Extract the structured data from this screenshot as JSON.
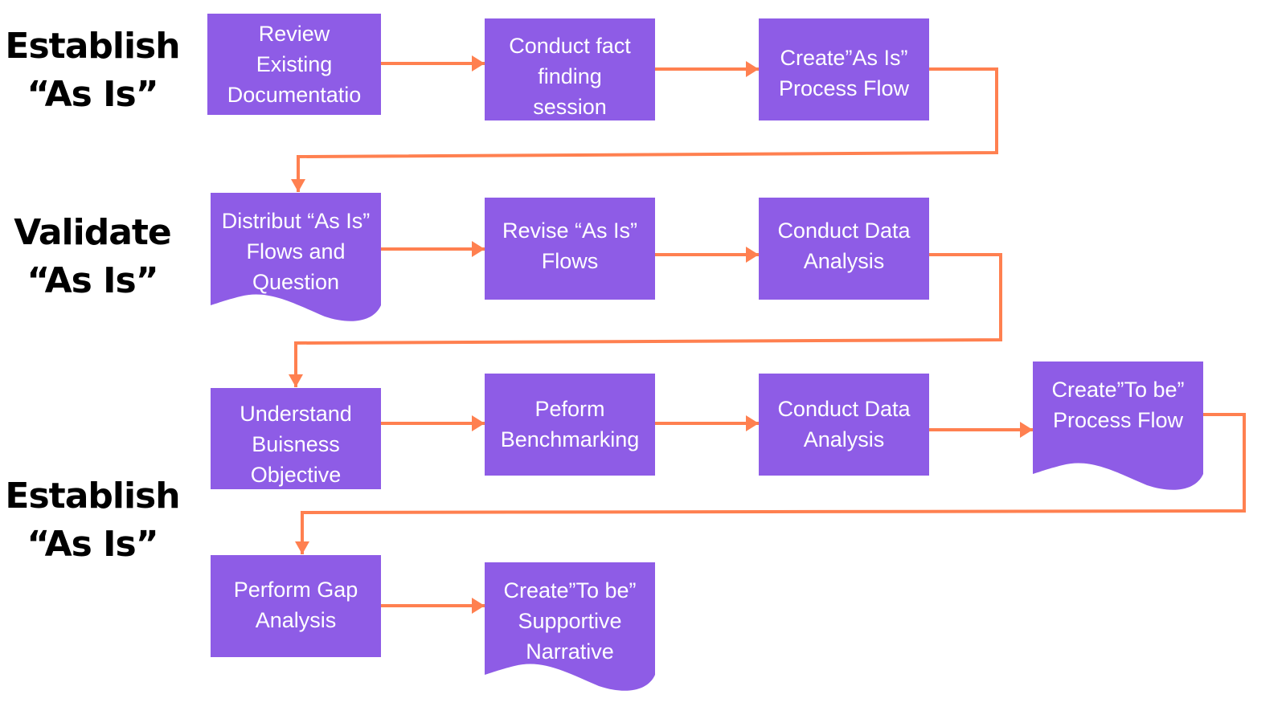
{
  "colors": {
    "box": "#8E5CE6",
    "connector": "#FF8050",
    "text": "#FFFFFF",
    "phase_text": "#000000"
  },
  "phases": [
    {
      "lines": [
        "Establish",
        "“As Is”"
      ]
    },
    {
      "lines": [
        "Validate",
        "“As Is”"
      ]
    },
    {
      "lines": [
        "Establish",
        "“As Is”"
      ]
    }
  ],
  "steps": [
    {
      "shape": "process",
      "lines": [
        "Review",
        "Existing",
        "Documentatio"
      ]
    },
    {
      "shape": "process",
      "lines": [
        "Conduct fact",
        "finding",
        "session"
      ]
    },
    {
      "shape": "process",
      "lines": [
        "Create”As Is”",
        "Process Flow"
      ]
    },
    {
      "shape": "document",
      "lines": [
        "Distribut “As Is”",
        "Flows and",
        "Question"
      ]
    },
    {
      "shape": "process",
      "lines": [
        "Revise “As Is”",
        "Flows"
      ]
    },
    {
      "shape": "process",
      "lines": [
        "Conduct Data",
        "Analysis"
      ]
    },
    {
      "shape": "process",
      "lines": [
        "Understand",
        "Buisness",
        "Objective"
      ]
    },
    {
      "shape": "process",
      "lines": [
        "Peform",
        "Benchmarking"
      ]
    },
    {
      "shape": "process",
      "lines": [
        "Conduct Data",
        "Analysis"
      ]
    },
    {
      "shape": "document",
      "lines": [
        "Create”To be”",
        "Process Flow"
      ]
    },
    {
      "shape": "process",
      "lines": [
        "Perform Gap",
        "Analysis"
      ]
    },
    {
      "shape": "document",
      "lines": [
        "Create”To be”",
        "Supportive",
        "Narrative"
      ]
    }
  ]
}
